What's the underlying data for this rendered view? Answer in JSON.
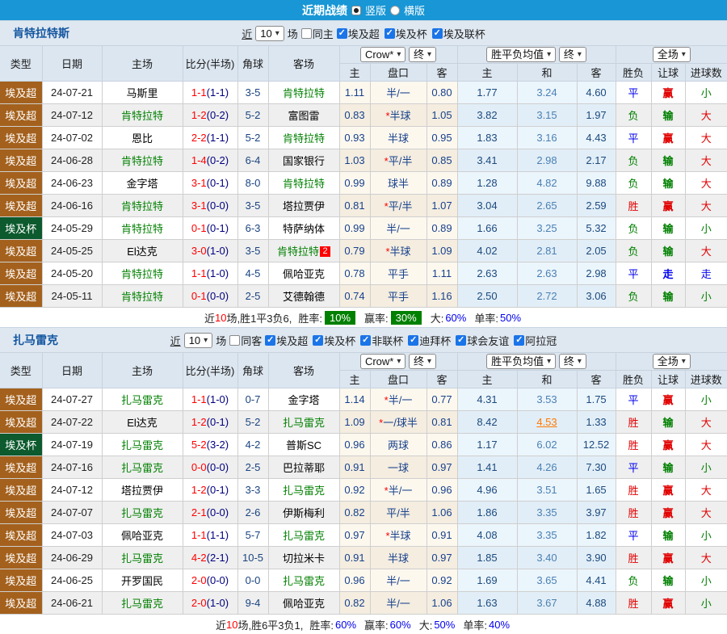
{
  "title_bar": {
    "title": "近期战绩",
    "option_vertical": "竖版",
    "option_horizontal": "横版",
    "selected_option": "竖版"
  },
  "head": {
    "type": "类型",
    "date": "日期",
    "home": "主场",
    "score": "比分(半场)",
    "corner": "角球",
    "away": "客场",
    "odds_home": "主",
    "handicap": "盘口",
    "odds_away": "客",
    "mean_home": "主",
    "mean_draw": "和",
    "mean_away": "客",
    "result": "胜负",
    "cover": "让球",
    "goals": "进球数",
    "source_select": "Crow*",
    "final_select": "终",
    "mean_select": "胜平负均值",
    "final_select2": "终",
    "scope_select": "全场"
  },
  "colors": {
    "accent_blue": "#1896d5",
    "type_league": "#a4611d",
    "type_cup": "#0c5a2d",
    "win_red": "#e10000",
    "draw_blue": "#0000ee",
    "lose_green": "#008000"
  },
  "sections": [
    {
      "team": "肯特拉特斯",
      "filter": {
        "near": "近",
        "count": "10",
        "games": "场",
        "same_label": "同主",
        "same_state": "",
        "competitions": [
          {
            "label": "埃及超",
            "state": "checked"
          },
          {
            "label": "埃及杯",
            "state": "checked"
          },
          {
            "label": "埃及联杯",
            "state": "checked"
          }
        ]
      },
      "rows": [
        {
          "type": "埃及超",
          "type_bg": "#a4611d",
          "date": "24-07-21",
          "home": "马斯里",
          "home_color": "#000000",
          "score": "1-1",
          "half": "(1-1)",
          "corners": "3-5",
          "away": "肯特拉特",
          "away_color": "#008000",
          "badge": "",
          "odds_home": "1.11",
          "star": "",
          "handicap": "半/一",
          "odds_away": "0.80",
          "mean_home": "1.77",
          "mean_draw": "3.24",
          "draw_class": "",
          "mean_away": "4.60",
          "result": "平",
          "result_color": "#0000ee",
          "cover": "赢",
          "cover_color": "#e10000",
          "goals": "小",
          "goals_color": "#008000"
        },
        {
          "type": "埃及超",
          "type_bg": "#a4611d",
          "date": "24-07-12",
          "home": "肯特拉特",
          "home_color": "#008000",
          "score": "1-2",
          "half": "(0-2)",
          "corners": "5-2",
          "away": "富图雷",
          "away_color": "#000000",
          "badge": "",
          "odds_home": "0.83",
          "star": "*",
          "handicap": "半球",
          "odds_away": "1.05",
          "mean_home": "3.82",
          "mean_draw": "3.15",
          "draw_class": "",
          "mean_away": "1.97",
          "result": "负",
          "result_color": "#008000",
          "cover": "输",
          "cover_color": "#008000",
          "goals": "大",
          "goals_color": "#e10000"
        },
        {
          "type": "埃及超",
          "type_bg": "#a4611d",
          "date": "24-07-02",
          "home": "恩比",
          "home_color": "#000000",
          "score": "2-2",
          "half": "(1-1)",
          "corners": "5-2",
          "away": "肯特拉特",
          "away_color": "#008000",
          "badge": "",
          "odds_home": "0.93",
          "star": "",
          "handicap": "半球",
          "odds_away": "0.95",
          "mean_home": "1.83",
          "mean_draw": "3.16",
          "draw_class": "",
          "mean_away": "4.43",
          "result": "平",
          "result_color": "#0000ee",
          "cover": "赢",
          "cover_color": "#e10000",
          "goals": "大",
          "goals_color": "#e10000"
        },
        {
          "type": "埃及超",
          "type_bg": "#a4611d",
          "date": "24-06-28",
          "home": "肯特拉特",
          "home_color": "#008000",
          "score": "1-4",
          "half": "(0-2)",
          "corners": "6-4",
          "away": "国家银行",
          "away_color": "#000000",
          "badge": "",
          "odds_home": "1.03",
          "star": "*",
          "handicap": "平/半",
          "odds_away": "0.85",
          "mean_home": "3.41",
          "mean_draw": "2.98",
          "draw_class": "",
          "mean_away": "2.17",
          "result": "负",
          "result_color": "#008000",
          "cover": "输",
          "cover_color": "#008000",
          "goals": "大",
          "goals_color": "#e10000"
        },
        {
          "type": "埃及超",
          "type_bg": "#a4611d",
          "date": "24-06-23",
          "home": "金字塔",
          "home_color": "#000000",
          "score": "3-1",
          "half": "(0-1)",
          "corners": "8-0",
          "away": "肯特拉特",
          "away_color": "#008000",
          "badge": "",
          "odds_home": "0.99",
          "star": "",
          "handicap": "球半",
          "odds_away": "0.89",
          "mean_home": "1.28",
          "mean_draw": "4.82",
          "draw_class": "",
          "mean_away": "9.88",
          "result": "负",
          "result_color": "#008000",
          "cover": "输",
          "cover_color": "#008000",
          "goals": "大",
          "goals_color": "#e10000"
        },
        {
          "type": "埃及超",
          "type_bg": "#a4611d",
          "date": "24-06-16",
          "home": "肯特拉特",
          "home_color": "#008000",
          "score": "3-1",
          "half": "(0-0)",
          "corners": "3-5",
          "away": "塔拉贾伊",
          "away_color": "#000000",
          "badge": "",
          "odds_home": "0.81",
          "star": "*",
          "handicap": "平/半",
          "odds_away": "1.07",
          "mean_home": "3.04",
          "mean_draw": "2.65",
          "draw_class": "",
          "mean_away": "2.59",
          "result": "胜",
          "result_color": "#e10000",
          "cover": "赢",
          "cover_color": "#e10000",
          "goals": "大",
          "goals_color": "#e10000"
        },
        {
          "type": "埃及杯",
          "type_bg": "#0c5a2d",
          "date": "24-05-29",
          "home": "肯特拉特",
          "home_color": "#008000",
          "score": "0-1",
          "half": "(0-1)",
          "corners": "6-3",
          "away": "特萨纳体",
          "away_color": "#000000",
          "badge": "",
          "odds_home": "0.99",
          "star": "",
          "handicap": "半/一",
          "odds_away": "0.89",
          "mean_home": "1.66",
          "mean_draw": "3.25",
          "draw_class": "",
          "mean_away": "5.32",
          "result": "负",
          "result_color": "#008000",
          "cover": "输",
          "cover_color": "#008000",
          "goals": "小",
          "goals_color": "#008000"
        },
        {
          "type": "埃及超",
          "type_bg": "#a4611d",
          "date": "24-05-25",
          "home": "El达克",
          "home_color": "#000000",
          "score": "3-0",
          "half": "(1-0)",
          "corners": "3-5",
          "away": "肯特拉特",
          "away_color": "#008000",
          "badge": "2",
          "odds_home": "0.79",
          "star": "*",
          "handicap": "半球",
          "odds_away": "1.09",
          "mean_home": "4.02",
          "mean_draw": "2.81",
          "draw_class": "",
          "mean_away": "2.05",
          "result": "负",
          "result_color": "#008000",
          "cover": "输",
          "cover_color": "#008000",
          "goals": "大",
          "goals_color": "#e10000"
        },
        {
          "type": "埃及超",
          "type_bg": "#a4611d",
          "date": "24-05-20",
          "home": "肯特拉特",
          "home_color": "#008000",
          "score": "1-1",
          "half": "(1-0)",
          "corners": "4-5",
          "away": "佩哈亚克",
          "away_color": "#000000",
          "badge": "",
          "odds_home": "0.78",
          "star": "",
          "handicap": "平手",
          "odds_away": "1.11",
          "mean_home": "2.63",
          "mean_draw": "2.63",
          "draw_class": "",
          "mean_away": "2.98",
          "result": "平",
          "result_color": "#0000ee",
          "cover": "走",
          "cover_color": "#0000ee",
          "goals": "走",
          "goals_color": "#0000ee"
        },
        {
          "type": "埃及超",
          "type_bg": "#a4611d",
          "date": "24-05-11",
          "home": "肯特拉特",
          "home_color": "#008000",
          "score": "0-1",
          "half": "(0-0)",
          "corners": "2-5",
          "away": "艾德翰德",
          "away_color": "#000000",
          "badge": "",
          "odds_home": "0.74",
          "star": "",
          "handicap": "平手",
          "odds_away": "1.16",
          "mean_home": "2.50",
          "mean_draw": "2.72",
          "draw_class": "",
          "mean_away": "3.06",
          "result": "负",
          "result_color": "#008000",
          "cover": "输",
          "cover_color": "#008000",
          "goals": "小",
          "goals_color": "#008000"
        }
      ],
      "summary": {
        "near": "近",
        "count": "10",
        "record": "场,胜1平3负6,",
        "win_label": "胜率:",
        "win_value": "10%",
        "win_class": "pct-box",
        "cover_label": "赢率:",
        "cover_value": "30%",
        "cover_class": "pct-box",
        "big_label": "大:",
        "big_value": "60%",
        "big_class": "pct-blue",
        "single_label": "单率:",
        "single_value": "50%",
        "single_class": "pct-blue"
      }
    },
    {
      "team": "扎马雷克",
      "filter": {
        "near": "近",
        "count": "10",
        "games": "场",
        "same_label": "同客",
        "same_state": "",
        "competitions": [
          {
            "label": "埃及超",
            "state": "checked"
          },
          {
            "label": "埃及杯",
            "state": "checked"
          },
          {
            "label": "非联杯",
            "state": "checked"
          },
          {
            "label": "迪拜杯",
            "state": "checked"
          },
          {
            "label": "球会友谊",
            "state": "checked"
          },
          {
            "label": "阿拉冠",
            "state": "checked"
          }
        ]
      },
      "rows": [
        {
          "type": "埃及超",
          "type_bg": "#a4611d",
          "date": "24-07-27",
          "home": "扎马雷克",
          "home_color": "#008000",
          "score": "1-1",
          "half": "(1-0)",
          "corners": "0-7",
          "away": "金字塔",
          "away_color": "#000000",
          "badge": "",
          "odds_home": "1.14",
          "star": "*",
          "handicap": "半/一",
          "odds_away": "0.77",
          "mean_home": "4.31",
          "mean_draw": "3.53",
          "draw_class": "",
          "mean_away": "1.75",
          "result": "平",
          "result_color": "#0000ee",
          "cover": "赢",
          "cover_color": "#e10000",
          "goals": "小",
          "goals_color": "#008000"
        },
        {
          "type": "埃及超",
          "type_bg": "#a4611d",
          "date": "24-07-22",
          "home": "El达克",
          "home_color": "#000000",
          "score": "1-2",
          "half": "(0-1)",
          "corners": "5-2",
          "away": "扎马雷克",
          "away_color": "#008000",
          "badge": "",
          "odds_home": "1.09",
          "star": "*",
          "handicap": "一/球半",
          "odds_away": "0.81",
          "mean_home": "8.42",
          "mean_draw": "4.53",
          "draw_class": "hot",
          "mean_away": "1.33",
          "result": "胜",
          "result_color": "#e10000",
          "cover": "输",
          "cover_color": "#008000",
          "goals": "大",
          "goals_color": "#e10000"
        },
        {
          "type": "埃及杯",
          "type_bg": "#0c5a2d",
          "date": "24-07-19",
          "home": "扎马雷克",
          "home_color": "#008000",
          "score": "5-2",
          "half": "(3-2)",
          "corners": "4-2",
          "away": "普斯SC",
          "away_color": "#000000",
          "badge": "",
          "odds_home": "0.96",
          "star": "",
          "handicap": "两球",
          "odds_away": "0.86",
          "mean_home": "1.17",
          "mean_draw": "6.02",
          "draw_class": "",
          "mean_away": "12.52",
          "result": "胜",
          "result_color": "#e10000",
          "cover": "赢",
          "cover_color": "#e10000",
          "goals": "大",
          "goals_color": "#e10000"
        },
        {
          "type": "埃及超",
          "type_bg": "#a4611d",
          "date": "24-07-16",
          "home": "扎马雷克",
          "home_color": "#008000",
          "score": "0-0",
          "half": "(0-0)",
          "corners": "2-5",
          "away": "巴拉蒂耶",
          "away_color": "#000000",
          "badge": "",
          "odds_home": "0.91",
          "star": "",
          "handicap": "一球",
          "odds_away": "0.97",
          "mean_home": "1.41",
          "mean_draw": "4.26",
          "draw_class": "",
          "mean_away": "7.30",
          "result": "平",
          "result_color": "#0000ee",
          "cover": "输",
          "cover_color": "#008000",
          "goals": "小",
          "goals_color": "#008000"
        },
        {
          "type": "埃及超",
          "type_bg": "#a4611d",
          "date": "24-07-12",
          "home": "塔拉贾伊",
          "home_color": "#000000",
          "score": "1-2",
          "half": "(0-1)",
          "corners": "3-3",
          "away": "扎马雷克",
          "away_color": "#008000",
          "badge": "",
          "odds_home": "0.92",
          "star": "*",
          "handicap": "半/一",
          "odds_away": "0.96",
          "mean_home": "4.96",
          "mean_draw": "3.51",
          "draw_class": "",
          "mean_away": "1.65",
          "result": "胜",
          "result_color": "#e10000",
          "cover": "赢",
          "cover_color": "#e10000",
          "goals": "大",
          "goals_color": "#e10000"
        },
        {
          "type": "埃及超",
          "type_bg": "#a4611d",
          "date": "24-07-07",
          "home": "扎马雷克",
          "home_color": "#008000",
          "score": "2-1",
          "half": "(0-0)",
          "corners": "2-6",
          "away": "伊斯梅利",
          "away_color": "#000000",
          "badge": "",
          "odds_home": "0.82",
          "star": "",
          "handicap": "平/半",
          "odds_away": "1.06",
          "mean_home": "1.86",
          "mean_draw": "3.35",
          "draw_class": "",
          "mean_away": "3.97",
          "result": "胜",
          "result_color": "#e10000",
          "cover": "赢",
          "cover_color": "#e10000",
          "goals": "大",
          "goals_color": "#e10000"
        },
        {
          "type": "埃及超",
          "type_bg": "#a4611d",
          "date": "24-07-03",
          "home": "佩哈亚克",
          "home_color": "#000000",
          "score": "1-1",
          "half": "(1-1)",
          "corners": "5-7",
          "away": "扎马雷克",
          "away_color": "#008000",
          "badge": "",
          "odds_home": "0.97",
          "star": "*",
          "handicap": "半球",
          "odds_away": "0.91",
          "mean_home": "4.08",
          "mean_draw": "3.35",
          "draw_class": "",
          "mean_away": "1.82",
          "result": "平",
          "result_color": "#0000ee",
          "cover": "输",
          "cover_color": "#008000",
          "goals": "小",
          "goals_color": "#008000"
        },
        {
          "type": "埃及超",
          "type_bg": "#a4611d",
          "date": "24-06-29",
          "home": "扎马雷克",
          "home_color": "#008000",
          "score": "4-2",
          "half": "(2-1)",
          "corners": "10-5",
          "away": "切拉米卡",
          "away_color": "#000000",
          "badge": "",
          "odds_home": "0.91",
          "star": "",
          "handicap": "半球",
          "odds_away": "0.97",
          "mean_home": "1.85",
          "mean_draw": "3.40",
          "draw_class": "",
          "mean_away": "3.90",
          "result": "胜",
          "result_color": "#e10000",
          "cover": "赢",
          "cover_color": "#e10000",
          "goals": "大",
          "goals_color": "#e10000"
        },
        {
          "type": "埃及超",
          "type_bg": "#a4611d",
          "date": "24-06-25",
          "home": "开罗国民",
          "home_color": "#000000",
          "score": "2-0",
          "half": "(0-0)",
          "corners": "0-0",
          "away": "扎马雷克",
          "away_color": "#008000",
          "badge": "",
          "odds_home": "0.96",
          "star": "",
          "handicap": "半/一",
          "odds_away": "0.92",
          "mean_home": "1.69",
          "mean_draw": "3.65",
          "draw_class": "",
          "mean_away": "4.41",
          "result": "负",
          "result_color": "#008000",
          "cover": "输",
          "cover_color": "#008000",
          "goals": "小",
          "goals_color": "#008000"
        },
        {
          "type": "埃及超",
          "type_bg": "#a4611d",
          "date": "24-06-21",
          "home": "扎马雷克",
          "home_color": "#008000",
          "score": "2-0",
          "half": "(1-0)",
          "corners": "9-4",
          "away": "佩哈亚克",
          "away_color": "#000000",
          "badge": "",
          "odds_home": "0.82",
          "star": "",
          "handicap": "半/一",
          "odds_away": "1.06",
          "mean_home": "1.63",
          "mean_draw": "3.67",
          "draw_class": "",
          "mean_away": "4.88",
          "result": "胜",
          "result_color": "#e10000",
          "cover": "赢",
          "cover_color": "#e10000",
          "goals": "小",
          "goals_color": "#008000"
        }
      ],
      "summary": {
        "near": "近",
        "count": "10",
        "record": "场,胜6平3负1,",
        "win_label": "胜率:",
        "win_value": "60%",
        "win_class": "pct-blue",
        "cover_label": "赢率:",
        "cover_value": "60%",
        "cover_class": "pct-blue",
        "big_label": "大:",
        "big_value": "50%",
        "big_class": "pct-blue",
        "single_label": "单率:",
        "single_value": "40%",
        "single_class": "pct-blue"
      }
    }
  ]
}
